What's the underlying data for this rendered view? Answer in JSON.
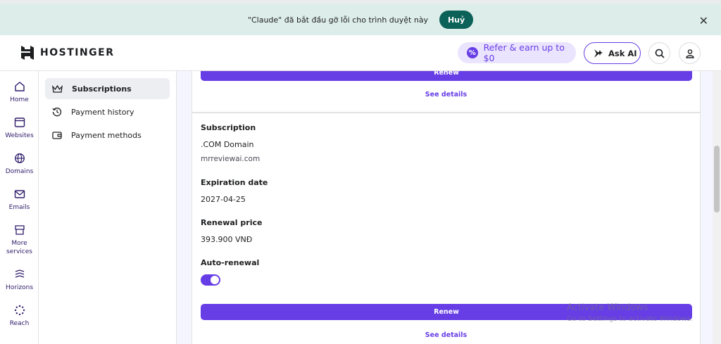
{
  "banner": {
    "text": "\"Claude\" đã bắt đầu gỡ lỗi cho trình duyệt này",
    "cancel_label": "Huỷ",
    "close_glyph": "✕"
  },
  "header": {
    "logo_text": "HOSTINGER",
    "refer_label": "Refer & earn up to $0",
    "ask_ai_label": "Ask AI",
    "icons": [
      "hostinger-logo",
      "percent-icon",
      "sparkle-icon",
      "search-icon",
      "user-icon"
    ]
  },
  "rail": {
    "items": [
      {
        "label": "Home",
        "icon": "home-icon"
      },
      {
        "label": "Websites",
        "icon": "browser-icon"
      },
      {
        "label": "Domains",
        "icon": "globe-icon"
      },
      {
        "label": "Emails",
        "icon": "mail-icon"
      },
      {
        "label": "More services",
        "icon": "store-icon"
      },
      {
        "label": "Horizons",
        "icon": "horizons-icon"
      },
      {
        "label": "Reach",
        "icon": "loader-icon"
      }
    ]
  },
  "subnav": {
    "items": [
      {
        "label": "Subscriptions",
        "icon": "crown-icon",
        "active": true
      },
      {
        "label": "Payment history",
        "icon": "history-icon",
        "active": false
      },
      {
        "label": "Payment methods",
        "icon": "wallet-icon",
        "active": false
      }
    ]
  },
  "main": {
    "top_card": {
      "renew_label": "Renew",
      "see_details_label": "See details"
    },
    "card": {
      "subscription_label": "Subscription",
      "subscription_name": ".COM Domain",
      "domain": "mrreviewai.com",
      "expiration_label": "Expiration date",
      "expiration_value": "2027-04-25",
      "renewal_price_label": "Renewal price",
      "renewal_price_value": "393.900 VNĐ",
      "auto_renewal_label": "Auto-renewal",
      "auto_renewal_on": true,
      "renew_label": "Renew",
      "see_details_label": "See details"
    }
  },
  "watermark": {
    "title": "Activate Windows",
    "subtitle": "Go to Settings to activate Windows."
  },
  "colors": {
    "accent": "#673de6",
    "banner_bg": "#ddeeea",
    "banner_button": "#0c6158"
  }
}
